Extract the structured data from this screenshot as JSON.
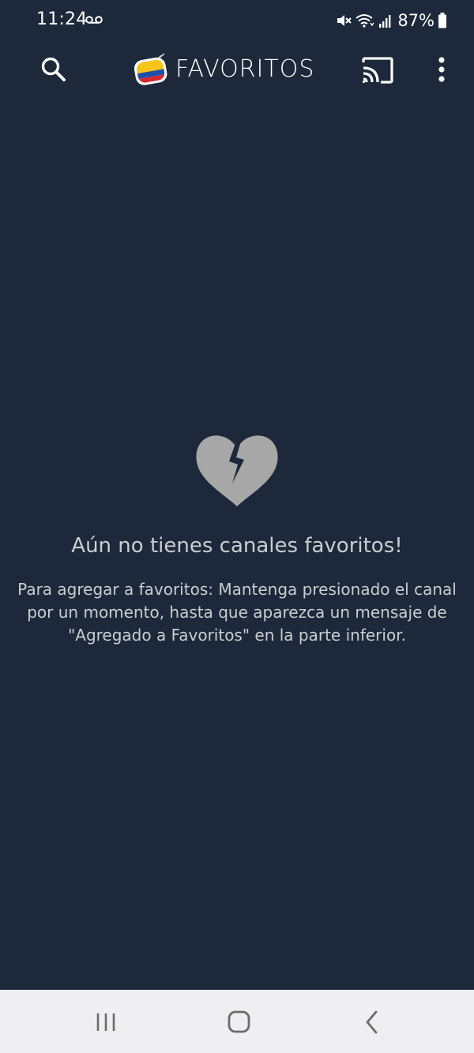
{
  "status_bar": {
    "time": "11:24",
    "battery": "87%",
    "icons": [
      "voicemail-icon",
      "mute-icon",
      "wifi-icon",
      "signal-icon",
      "battery-icon"
    ]
  },
  "app_bar": {
    "title": "FAVORITOS",
    "icons": [
      "search-icon",
      "colombia-tv-logo",
      "cast-icon",
      "more-vert-icon"
    ]
  },
  "empty_state": {
    "icon": "broken-heart-icon",
    "title": "Aún no tienes canales favoritos!",
    "description_lines": [
      "Para agregar a favoritos: Mantenga presionado el canal",
      "por un momento, hasta que aparezca un mensaje de",
      "\"Agregado a Favoritos\" en la parte inferior."
    ]
  },
  "nav_bar": {
    "icons": [
      "recents-icon",
      "home-icon",
      "back-icon"
    ]
  },
  "colors": {
    "background": "#1d293a",
    "heart": "#a7a7a7",
    "nav_bar": "#efeff1",
    "text_muted": "#c9ccd2"
  }
}
